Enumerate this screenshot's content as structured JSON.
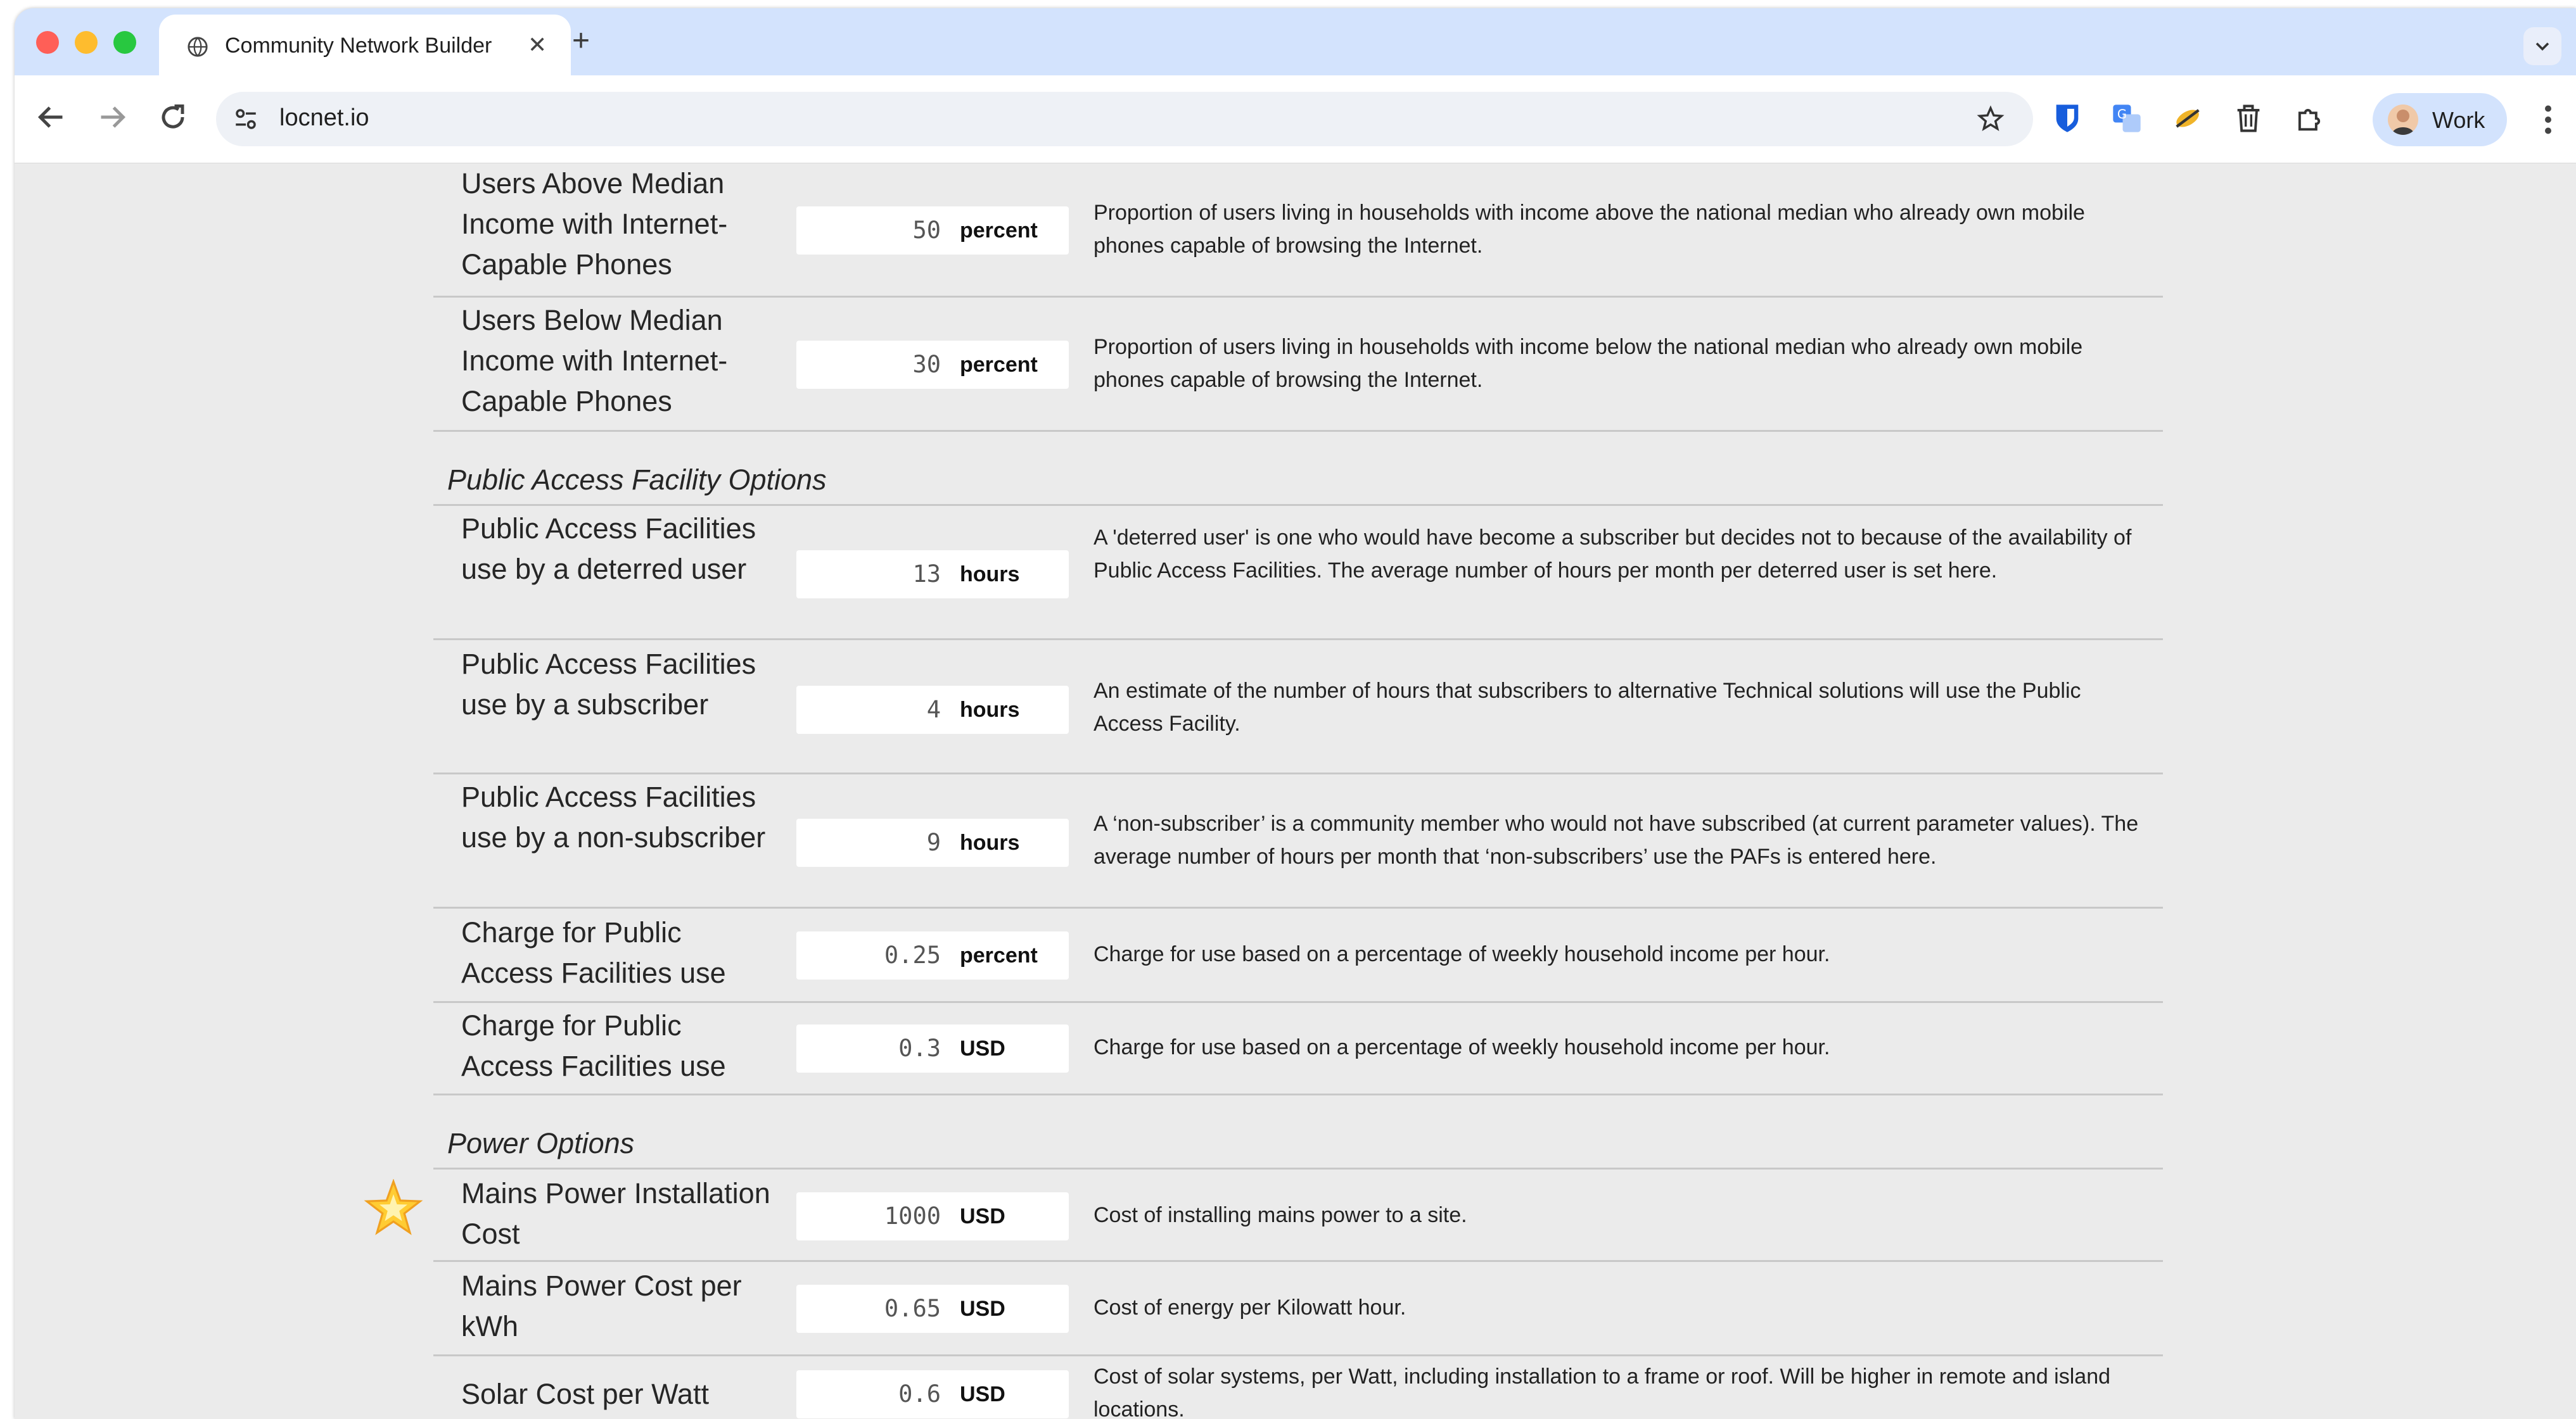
{
  "browser": {
    "tab_title": "Community Network Builder",
    "new_tab_symbol": "+",
    "close_symbol": "✕",
    "url": "locnet.io",
    "profile_name": "Work",
    "icons": [
      "globe-icon",
      "back-arrow-icon",
      "forward-arrow-icon",
      "reload-icon",
      "site-settings-icon",
      "bookmark-star-icon",
      "bitwarden-icon",
      "translate-icon",
      "extension-icon",
      "trash-icon",
      "puzzle-icon",
      "kebab-menu-icon",
      "tab-menu-chevron-icon"
    ]
  },
  "rows_top": [
    {
      "name": "Users Above Median Income with Internet-Capable Phones",
      "value": "50",
      "unit": "percent",
      "description": "Proportion of users living in households with income above the national median who already own mobile phones capable of browsing the Internet."
    },
    {
      "name": "Users Below Median Income with Internet-Capable Phones",
      "value": "30",
      "unit": "percent",
      "description": "Proportion of users living in households with income below the national median who already own mobile phones capable of browsing the Internet."
    }
  ],
  "section_paf": {
    "title": "Public Access Facility Options",
    "rows": [
      {
        "name": "Public Access Facilities use by a deterred user",
        "value": "13",
        "unit": "hours",
        "description": "A 'deterred user' is one who would have become a subscriber but decides not to because of the availability of Public Access Facilities. The average number of hours per month per deterred user is set here."
      },
      {
        "name": "Public Access Facilities use by a subscriber",
        "value": "4",
        "unit": "hours",
        "description": "An estimate of the number of hours that subscribers to alternative Technical solutions will use the Public Access Facility."
      },
      {
        "name": "Public Access Facilities use by a non-subscriber",
        "value": "9",
        "unit": "hours",
        "description": "A ‘non-subscriber’ is a community member who would not have subscribed (at current parameter values). The average number of hours per month that ‘non-subscribers’ use the PAFs is entered here."
      },
      {
        "name": "Charge for Public Access Facilities use",
        "value": "0.25",
        "unit": "percent",
        "description": "Charge for use based on a percentage of weekly household income per hour."
      },
      {
        "name": "Charge for Public Access Facilities use",
        "value": "0.3",
        "unit": "USD",
        "description": "Charge for use based on a percentage of weekly household income per hour."
      }
    ]
  },
  "section_power": {
    "title": "Power Options",
    "rows": [
      {
        "name": "Mains Power Installation Cost",
        "value": "1000",
        "unit": "USD",
        "description": "Cost of installing mains power to a site."
      },
      {
        "name": "Mains Power Cost per kWh",
        "value": "0.65",
        "unit": "USD",
        "description": "Cost of energy per Kilowatt hour."
      },
      {
        "name": "Solar Cost per Watt",
        "value": "0.6",
        "unit": "USD",
        "description": "Cost of solar systems, per Watt, including installation to a frame or roof. Will be higher in remote and island locations."
      }
    ]
  },
  "decor": {
    "star_icon": "glowing-star-icon"
  }
}
